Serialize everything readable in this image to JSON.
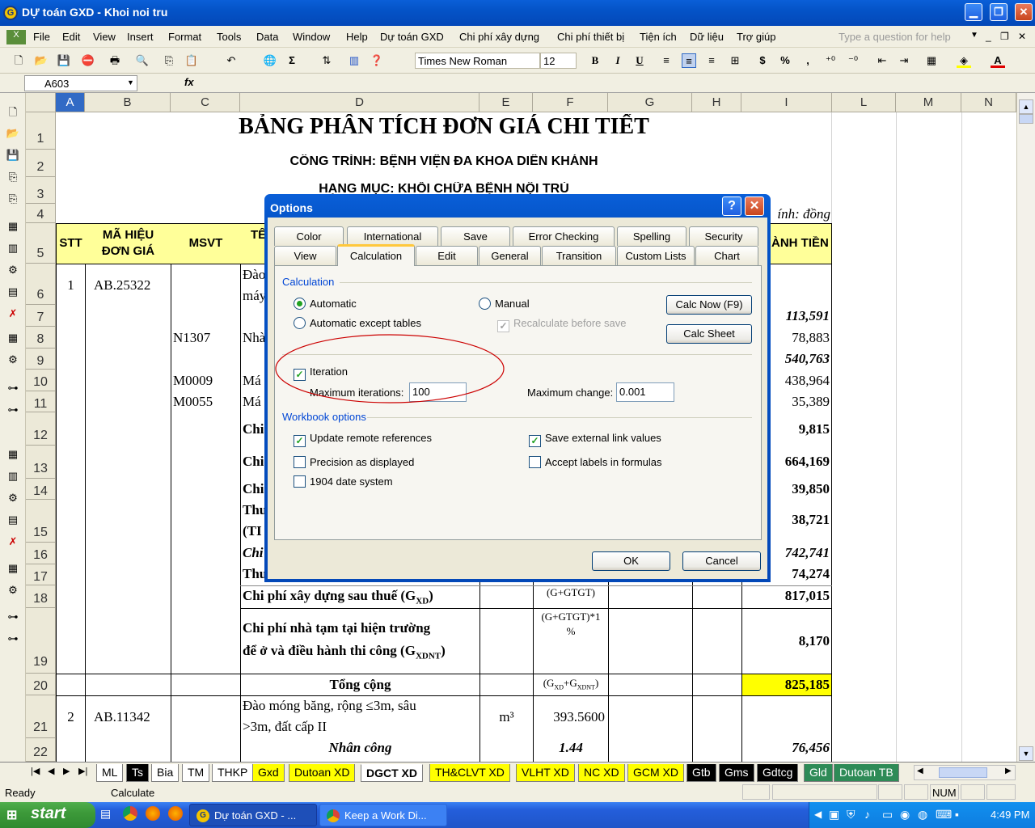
{
  "window": {
    "title": "DỰ toán GXD - Khoi noi tru"
  },
  "menu": [
    "File",
    "Edit",
    "View",
    "Insert",
    "Format",
    "Tools",
    "Data",
    "Window",
    "Help",
    "Dự toán GXD",
    "Chi phí xây dựng",
    "Chi phí thiết bị",
    "Tiện ích",
    "Dữ liệu",
    "Trợ giúp"
  ],
  "help_placeholder": "Type a question for help",
  "toolbar": {
    "font": "Times New Roman",
    "size": "12",
    "sigma": "Σ",
    "bold": "B",
    "italic": "I",
    "underline": "U",
    "dollar": "$",
    "percent": "%",
    "comma": ","
  },
  "formula": {
    "namebox": "A603",
    "fx": "fx"
  },
  "columns": [
    "A",
    "B",
    "C",
    "D",
    "E",
    "F",
    "G",
    "H",
    "I",
    "L",
    "M",
    "N"
  ],
  "sheet": {
    "title": "BẢNG PHÂN TÍCH ĐƠN GIÁ CHI TIẾT",
    "project": "CÔNG TRÌNH: BỆNH VIỆN ĐA KHOA DIÊN KHÁNH",
    "category": "HẠNG MỤC: KHỐI CHỮA BỆNH NỘI TRÚ",
    "unit_note": "ính: đồng",
    "hdr_stt": "STT",
    "hdr_code": "MÃ HIỆU ĐƠN GIÁ",
    "hdr_msvt": "MSVT",
    "hdr_name": "TÊ",
    "hdr_amount": "ÀNH TIỀN",
    "r6_stt": "1",
    "r6_code": "AB.25322",
    "r6_d1": "Đào",
    "r6_d2": "máy",
    "r7_i": "113,591",
    "r8_c": "N1307",
    "r8_d": "Nhà",
    "r8_i": "78,883",
    "r9_i": "540,763",
    "r10_c": "M0009",
    "r10_d": "Má",
    "r10_i": "438,964",
    "r11_c": "M0055",
    "r11_d": "Má",
    "r11_i": "35,389",
    "r12_d": "Chi",
    "r12_i": "9,815",
    "r13_d": "Chi",
    "r13_i": "664,169",
    "r14_d": "Chi",
    "r14_i": "39,850",
    "r15_d1": "Thu",
    "r15_d2": "(TI",
    "r15_i": "38,721",
    "r16_d": "Chi",
    "r16_i": "742,741",
    "r17_d": "Thu",
    "r17_i": "74,274",
    "r18_d": "Chi phí xây dựng sau thuế (G",
    "r18_sub": "XD",
    "r18_end": ")",
    "r18_f": "(G+GTGT)",
    "r18_i": "817,015",
    "r19_d1": "Chi phí nhà tạm tại hiện trường",
    "r19_d2": "để ở và điều hành thi công (G",
    "r19_sub": "XDNT",
    "r19_end": ")",
    "r19_f1": "(G+GTGT)*1",
    "r19_f2": "%",
    "r19_i": "8,170",
    "r20_d": "Tổng cộng",
    "r20_f": "(G",
    "r20_fs1": "XD",
    "r20_fm": "+G",
    "r20_fs2": "XDNT",
    "r20_fe": ")",
    "r20_i": "825,185",
    "r21_stt": "2",
    "r21_code": "AB.11342",
    "r21_d1": "Đào móng băng, rộng ≤3m, sâu",
    "r21_d2": ">3m, đất cấp II",
    "r21_e": "m³",
    "r21_f": "393.5600",
    "r22_d": "Nhân công",
    "r22_f": "1.44",
    "r22_i": "76,456"
  },
  "rows": [
    "1",
    "2",
    "3",
    "4",
    "5",
    "6",
    "7",
    "8",
    "9",
    "10",
    "11",
    "12",
    "13",
    "14",
    "15",
    "16",
    "17",
    "18",
    "19",
    "20",
    "21",
    "22"
  ],
  "dialog": {
    "title": "Options",
    "help": "?",
    "close": "✕",
    "tabs_row1": [
      "Color",
      "International",
      "Save",
      "Error Checking",
      "Spelling",
      "Security"
    ],
    "tabs_row2": [
      "View",
      "Calculation",
      "Edit",
      "General",
      "Transition",
      "Custom Lists",
      "Chart"
    ],
    "calc_group": "Calculation",
    "automatic": "Automatic",
    "auto_except": "Automatic except tables",
    "manual": "Manual",
    "recalc": "Recalculate before save",
    "calc_now": "Calc Now (F9)",
    "calc_sheet": "Calc Sheet",
    "iteration": "Iteration",
    "max_iter_label": "Maximum iterations:",
    "max_iter": "100",
    "max_change_label": "Maximum change:",
    "max_change": "0.001",
    "wb_group": "Workbook options",
    "update_remote": "Update remote references",
    "precision": "Precision as displayed",
    "date1904": "1904 date system",
    "save_ext": "Save external link values",
    "accept_labels": "Accept labels in formulas",
    "ok": "OK",
    "cancel": "Cancel"
  },
  "sheet_tabs": [
    "ML",
    "Ts",
    "Bia",
    "TM",
    "THKP",
    "Gxd",
    "Dutoan XD",
    "DGCT XD",
    "TH&CLVT XD",
    "VLHT XD",
    "NC XD",
    "GCM XD",
    "Gtb",
    "Gms",
    "Gdtcg",
    "Gld",
    "Dutoan TB"
  ],
  "status": {
    "ready": "Ready",
    "calc": "Calculate",
    "num": "NUM"
  },
  "taskbar": {
    "start": "start",
    "task1": "Dự toán GXD - ...",
    "task2": "Keep a Work Di...",
    "time": "4:49 PM"
  },
  "colors": {
    "header_yellow": "#ffff99",
    "total_yellow": "#ffff00",
    "title_blue": "#0453c7",
    "ellipse": "#cc0000"
  }
}
